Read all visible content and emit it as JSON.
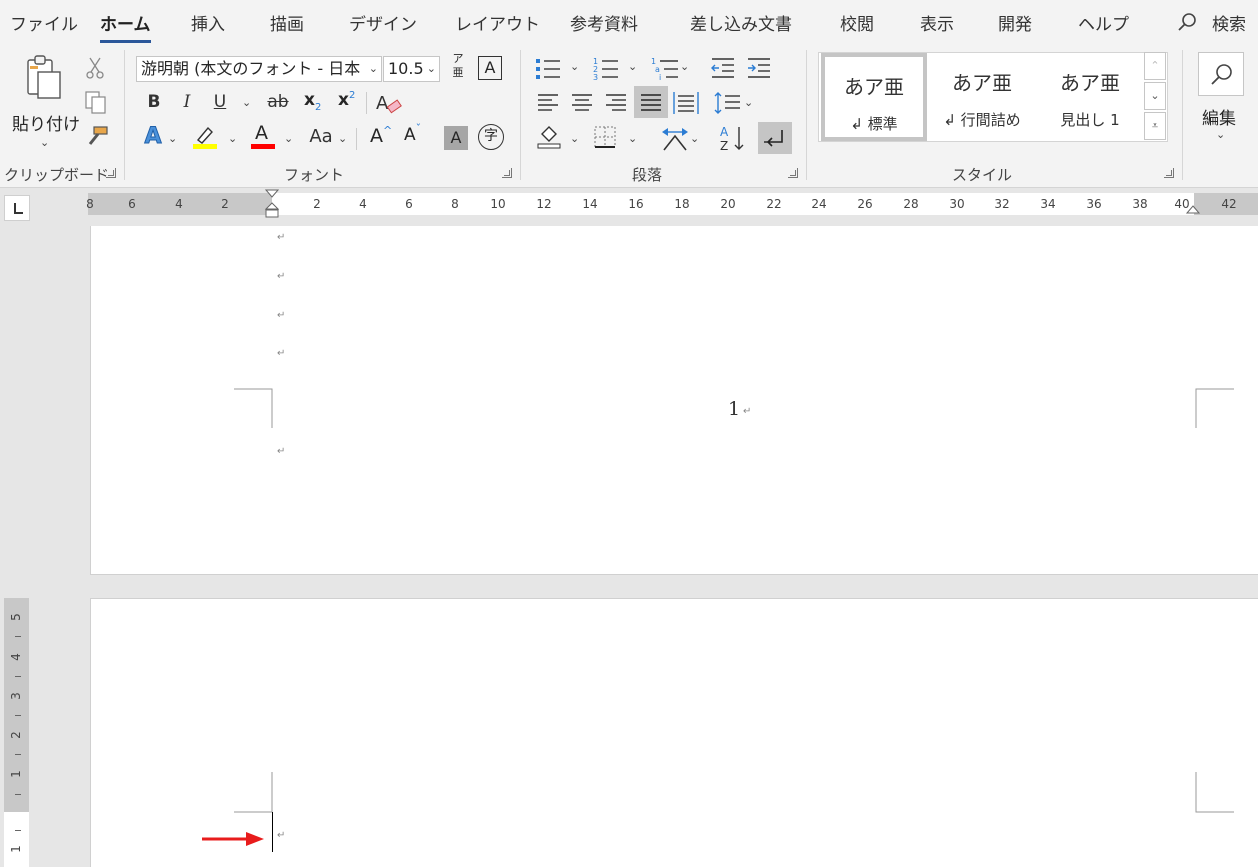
{
  "tabs": [
    {
      "id": "file",
      "label": "ファイル"
    },
    {
      "id": "home",
      "label": "ホーム"
    },
    {
      "id": "insert",
      "label": "挿入"
    },
    {
      "id": "draw",
      "label": "描画"
    },
    {
      "id": "design",
      "label": "デザイン"
    },
    {
      "id": "layout",
      "label": "レイアウト"
    },
    {
      "id": "references",
      "label": "参考資料"
    },
    {
      "id": "mailings",
      "label": "差し込み文書"
    },
    {
      "id": "review",
      "label": "校閲"
    },
    {
      "id": "view",
      "label": "表示"
    },
    {
      "id": "developer",
      "label": "開発"
    },
    {
      "id": "help",
      "label": "ヘルプ"
    }
  ],
  "search": {
    "label": "検索",
    "icon": "search-icon"
  },
  "clipboard": {
    "group_label": "クリップボード",
    "paste_label": "貼り付け"
  },
  "font": {
    "group_label": "フォント",
    "font_name": "游明朝 (本文のフォント - 日本",
    "font_size": "10.5",
    "phonetic_top": "ア",
    "phonetic_bottom": "亜",
    "bold": "B",
    "italic": "I",
    "underline": "U",
    "strikethrough": "ab",
    "subscript": "x",
    "subscript_mark": "2",
    "superscript": "x",
    "superscript_mark": "2",
    "text_effect": "A",
    "font_color": "A",
    "change_case": "Aa",
    "grow": "A",
    "shrink": "A",
    "shading": "A",
    "enclose": "字",
    "highlight_color": "#ffff00",
    "font_color_value": "#ff0000"
  },
  "paragraph": {
    "group_label": "段落"
  },
  "styles": {
    "group_label": "スタイル",
    "items": [
      {
        "preview": "あア亜",
        "name": "↲ 標準"
      },
      {
        "preview": "あア亜",
        "name": "↲ 行間詰め"
      },
      {
        "preview": "あア亜",
        "name": "見出し 1"
      }
    ]
  },
  "editing": {
    "label": "編集"
  },
  "ruler": {
    "left_labels": [
      "8",
      "6",
      "4",
      "2"
    ],
    "right_labels": [
      "2",
      "4",
      "6",
      "8",
      "10",
      "12",
      "14",
      "16",
      "18",
      "20",
      "22",
      "24",
      "26",
      "28",
      "30",
      "32",
      "34",
      "36",
      "38",
      "40",
      "42"
    ],
    "vertical_labels": [
      "5",
      "4",
      "3",
      "2",
      "1",
      "1"
    ]
  },
  "document": {
    "page_number": "1",
    "para_mark": "↵"
  },
  "colors": {
    "accent": "#2b579a",
    "annotation_arrow": "#e81c1c"
  }
}
